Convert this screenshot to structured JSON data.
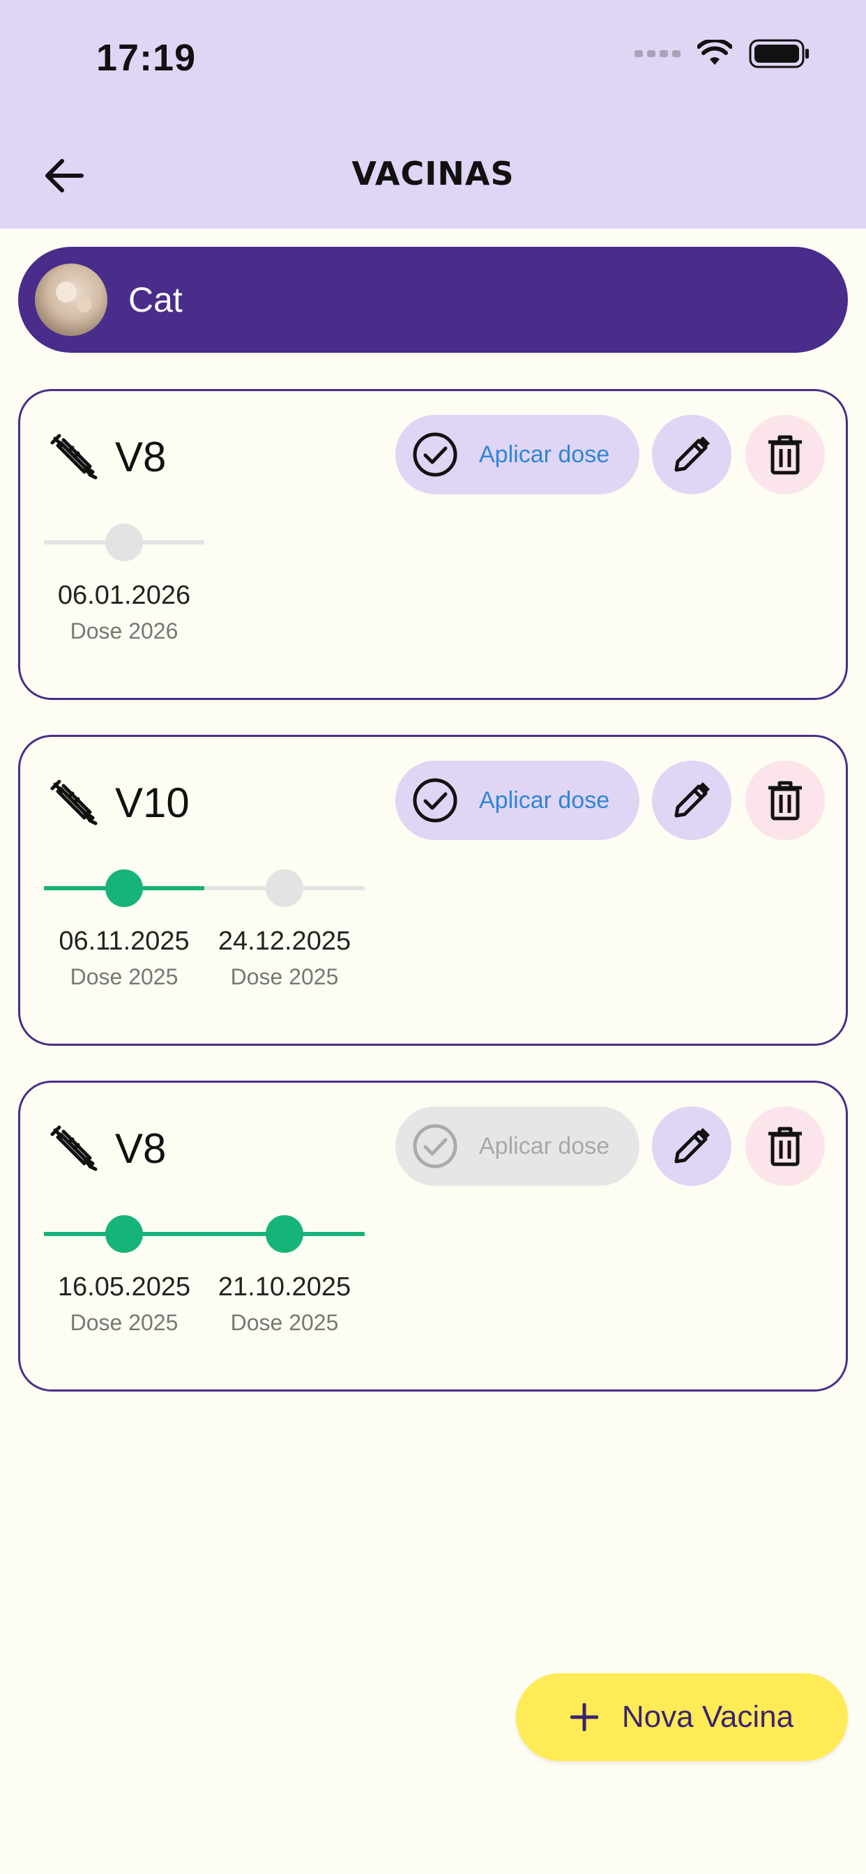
{
  "status_bar": {
    "time": "17:19"
  },
  "header": {
    "title": "VACINAS"
  },
  "pet": {
    "name": "Cat"
  },
  "vaccines": [
    {
      "name": "V8",
      "apply_label": "Aplicar dose",
      "apply_enabled": true,
      "doses": [
        {
          "date": "06.01.2026",
          "label": "Dose 2026",
          "applied": false
        }
      ]
    },
    {
      "name": "V10",
      "apply_label": "Aplicar dose",
      "apply_enabled": true,
      "doses": [
        {
          "date": "06.11.2025",
          "label": "Dose 2025",
          "applied": true
        },
        {
          "date": "24.12.2025",
          "label": "Dose 2025",
          "applied": false
        }
      ]
    },
    {
      "name": "V8",
      "apply_label": "Aplicar dose",
      "apply_enabled": false,
      "doses": [
        {
          "date": "16.05.2025",
          "label": "Dose 2025",
          "applied": true
        },
        {
          "date": "21.10.2025",
          "label": "Dose 2025",
          "applied": true
        }
      ]
    }
  ],
  "fab": {
    "label": "Nova Vacina"
  },
  "colors": {
    "header_bg": "#E0D5F5",
    "accent_purple": "#4A2C8A",
    "applied_green": "#16B37A",
    "pending_grey": "#E3E3E3",
    "apply_text_blue": "#2F86D6",
    "delete_bg": "#FBE4EA",
    "fab_yellow": "#FFEB55"
  }
}
